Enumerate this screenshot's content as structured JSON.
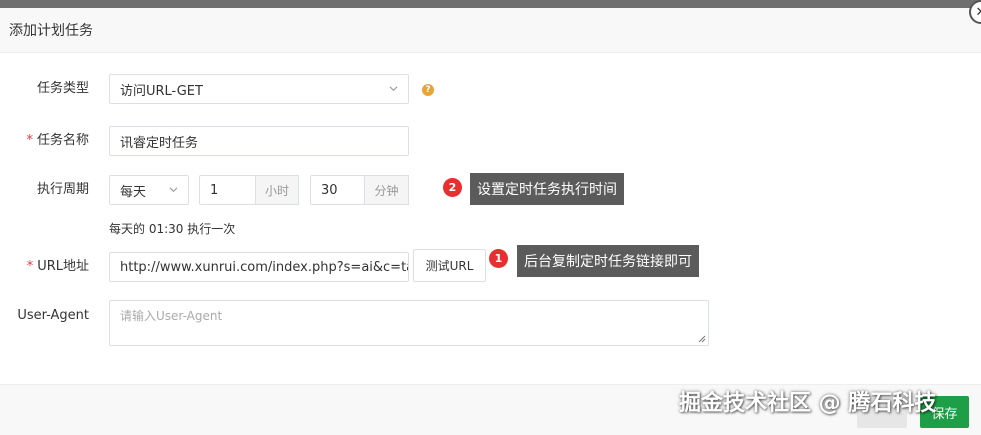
{
  "dialog": {
    "title": "添加计划任务",
    "close_icon": "close-icon"
  },
  "form": {
    "task_type": {
      "label": "任务类型",
      "value": "访问URL-GET",
      "help": "?"
    },
    "task_name": {
      "label": "任务名称",
      "required_mark": "*",
      "value": "讯睿定时任务"
    },
    "cycle": {
      "label": "执行周期",
      "period": "每天",
      "hours_value": "1",
      "hours_unit": "小时",
      "minutes_value": "30",
      "minutes_unit": "分钟",
      "summary": "每天的 01:30 执行一次"
    },
    "url": {
      "label": "URL地址",
      "required_mark": "*",
      "value": "http://www.xunrui.com/index.php?s=ai&c=task&",
      "test_button": "测试URL"
    },
    "user_agent": {
      "label": "User-Agent",
      "placeholder": "请输入User-Agent"
    }
  },
  "annotations": [
    {
      "number": "2",
      "text": "设置定时任务执行时间"
    },
    {
      "number": "1",
      "text": "后台复制定时任务链接即可"
    }
  ],
  "footer": {
    "secondary_label": "",
    "primary_label": "保存"
  },
  "watermark": "掘金技术社区 @ 腾石科技",
  "colors": {
    "required": "#e4393c",
    "badge": "#e82f2f",
    "callout": "#5b5b5b",
    "primary": "#1e9e47",
    "help": "#e8a33d"
  }
}
